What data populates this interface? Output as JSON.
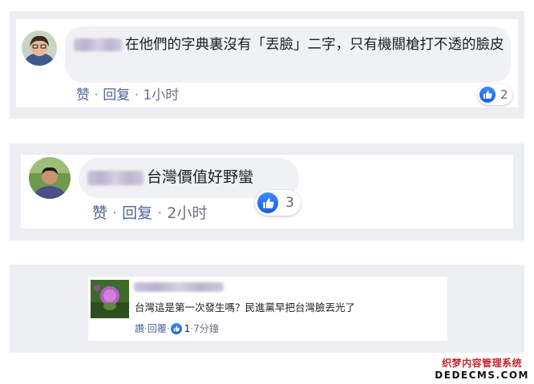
{
  "comment1": {
    "text": "在他們的字典裏沒有「丟臉」二字，只有機關槍打不透的臉皮",
    "actions": {
      "like": "赞",
      "reply": "回复",
      "time": "1小时",
      "sep": " · "
    },
    "reaction_count": "2"
  },
  "comment2": {
    "text": "台灣價值好野蠻",
    "actions": {
      "like": "赞",
      "reply": "回复",
      "time": "2小时",
      "sep": " · "
    },
    "reaction_count": "3"
  },
  "comment3": {
    "text": "台灣這是第一次發生嗎？民進黨早把台灣臉丟光了",
    "actions": {
      "like": "讚",
      "reply": "回覆",
      "time": "7分鐘",
      "sep": " · "
    },
    "reaction_count": "1"
  },
  "watermark": {
    "line1": "织梦内容管理系统",
    "line2": "DEDECMS.COM"
  },
  "colors": {
    "like_blue": "#1a6ff2",
    "link": "#4f6598",
    "panel_bg": "#eceef1"
  }
}
